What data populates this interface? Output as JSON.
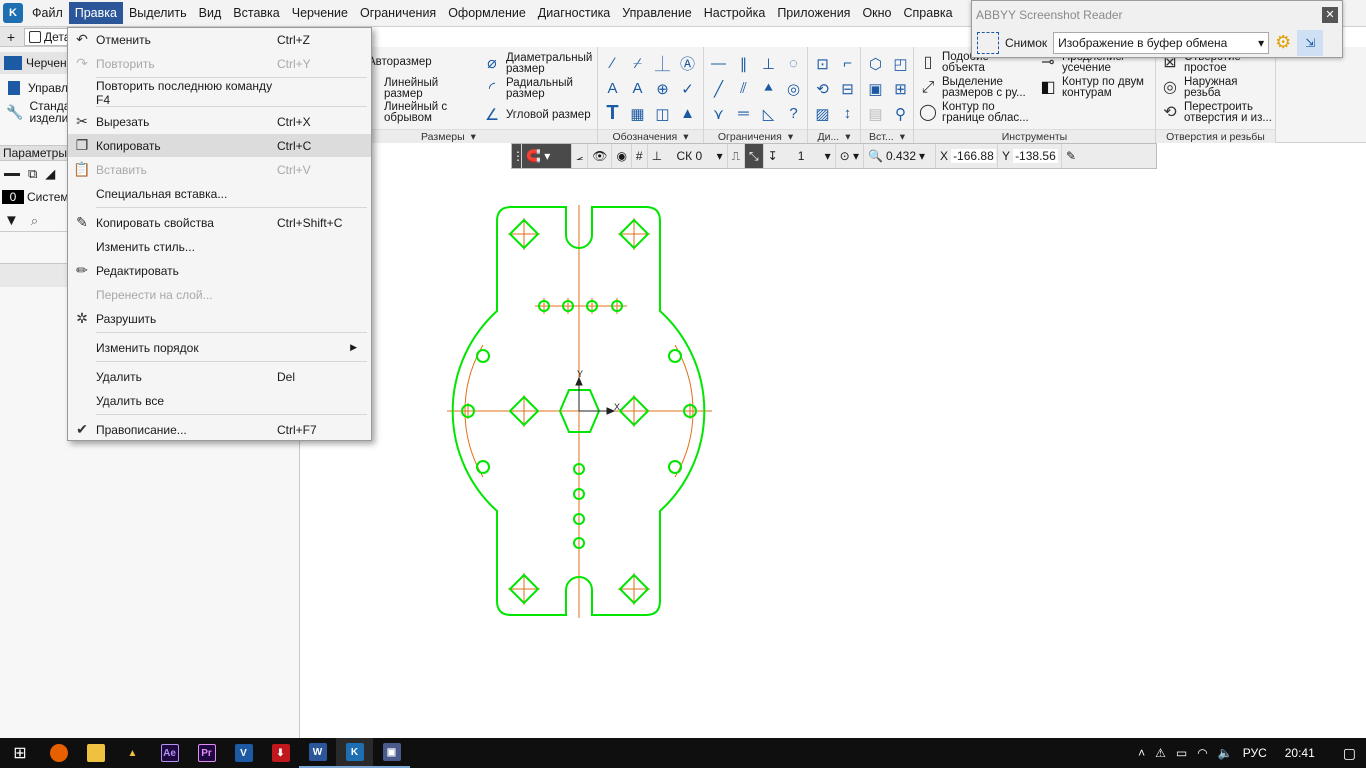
{
  "menubar": {
    "items": [
      "Файл",
      "Правка",
      "Выделить",
      "Вид",
      "Вставка",
      "Черчение",
      "Ограничения",
      "Оформление",
      "Диагностика",
      "Управление",
      "Настройка",
      "Приложения",
      "Окно",
      "Справка"
    ],
    "active_index": 1
  },
  "tabs": {
    "doc_tab": "Дета"
  },
  "leftpanel": {
    "tab_label": "Черчен",
    "manage_label": "Управл",
    "std_label_1": "Стандар",
    "std_label_2": "изделия",
    "params_label": "Параметры",
    "layer_num": "0",
    "layer_label": "Систем"
  },
  "dropdown": {
    "items": [
      {
        "label": "Отменить",
        "shortcut": "Ctrl+Z",
        "icon": "undo-icon",
        "enabled": true
      },
      {
        "label": "Повторить",
        "shortcut": "Ctrl+Y",
        "icon": "redo-icon",
        "enabled": false
      },
      {
        "label": "Повторить последнюю команду F4",
        "shortcut": "",
        "icon": "",
        "enabled": true
      },
      {
        "label": "Вырезать",
        "shortcut": "Ctrl+X",
        "icon": "scissors-icon",
        "enabled": true
      },
      {
        "label": "Копировать",
        "shortcut": "Ctrl+C",
        "icon": "copy-icon",
        "enabled": true
      },
      {
        "label": "Вставить",
        "shortcut": "Ctrl+V",
        "icon": "paste-icon",
        "enabled": false
      },
      {
        "label": "Специальная вставка...",
        "shortcut": "",
        "icon": "",
        "enabled": true
      },
      {
        "label": "Копировать свойства",
        "shortcut": "Ctrl+Shift+C",
        "icon": "eyedropper-icon",
        "enabled": true
      },
      {
        "label": "Изменить стиль...",
        "shortcut": "",
        "icon": "",
        "enabled": true
      },
      {
        "label": "Редактировать",
        "shortcut": "",
        "icon": "pencil-icon",
        "enabled": true
      },
      {
        "label": "Перенести на слой...",
        "shortcut": "",
        "icon": "",
        "enabled": false
      },
      {
        "label": "Разрушить",
        "shortcut": "",
        "icon": "explode-icon",
        "enabled": true
      },
      {
        "label": "Изменить порядок",
        "shortcut": "",
        "icon": "",
        "enabled": true
      },
      {
        "label": "Удалить",
        "shortcut": "Del",
        "icon": "",
        "enabled": true
      },
      {
        "label": "Удалить все",
        "shortcut": "",
        "icon": "",
        "enabled": true
      },
      {
        "label": "Правописание...",
        "shortcut": "Ctrl+F7",
        "icon": "checkmark-icon",
        "enabled": true
      }
    ],
    "highlighted_index": 4
  },
  "ribbon": {
    "dims": {
      "group_label": "Размеры",
      "autodim": "Авторазмер",
      "linear": "Линейный",
      "linear2": "размер",
      "linear_break": "Линейный с",
      "linear_break2": "обрывом",
      "diam": "Диаметральный",
      "diam2": "размер",
      "radial": "Радиальный",
      "radial2": "размер",
      "angular": "Угловой размер"
    },
    "groups": {
      "oboz": "Обозначения",
      "ogr": "Ограничения",
      "di": "Ди...",
      "vst": "Вст...",
      "tools": "Инструменты",
      "holes": "Отверстия и резьбы"
    },
    "tools": {
      "similar": "Подобие",
      "similar2": "объекта",
      "select_dims": "Выделение",
      "select_dims2": "размеров с ру...",
      "contour_area": "Контур по",
      "contour_area2": "границе облас...",
      "extend": "Продление/",
      "extend2": "усечение",
      "contour_two": "Контур по двум",
      "contour_two2": "контурам"
    },
    "holes": {
      "simple": "Отверстие",
      "simple2": "простое",
      "outer_thread": "Наружная",
      "outer_thread2": "резьба",
      "rebuild": "Перестроить",
      "rebuild2": "отверстия и из..."
    }
  },
  "canvas_toolbar": {
    "cs": "СК 0",
    "layer": "1",
    "zoom": "0.432",
    "x_label": "X",
    "x_value": "-166.88",
    "y_label": "Y",
    "y_value": "-138.56"
  },
  "abbyy": {
    "title": "ABBYY Screenshot Reader",
    "snap_label": "Снимок",
    "target": "Изображение в буфер обмена"
  },
  "axes": {
    "x": "X",
    "y": "Y"
  },
  "taskbar": {
    "lang": "РУС",
    "time": "20:41"
  },
  "colors": {
    "accent": "#2b579a",
    "drawing": "#00e600",
    "centerline": "#e0701a"
  }
}
